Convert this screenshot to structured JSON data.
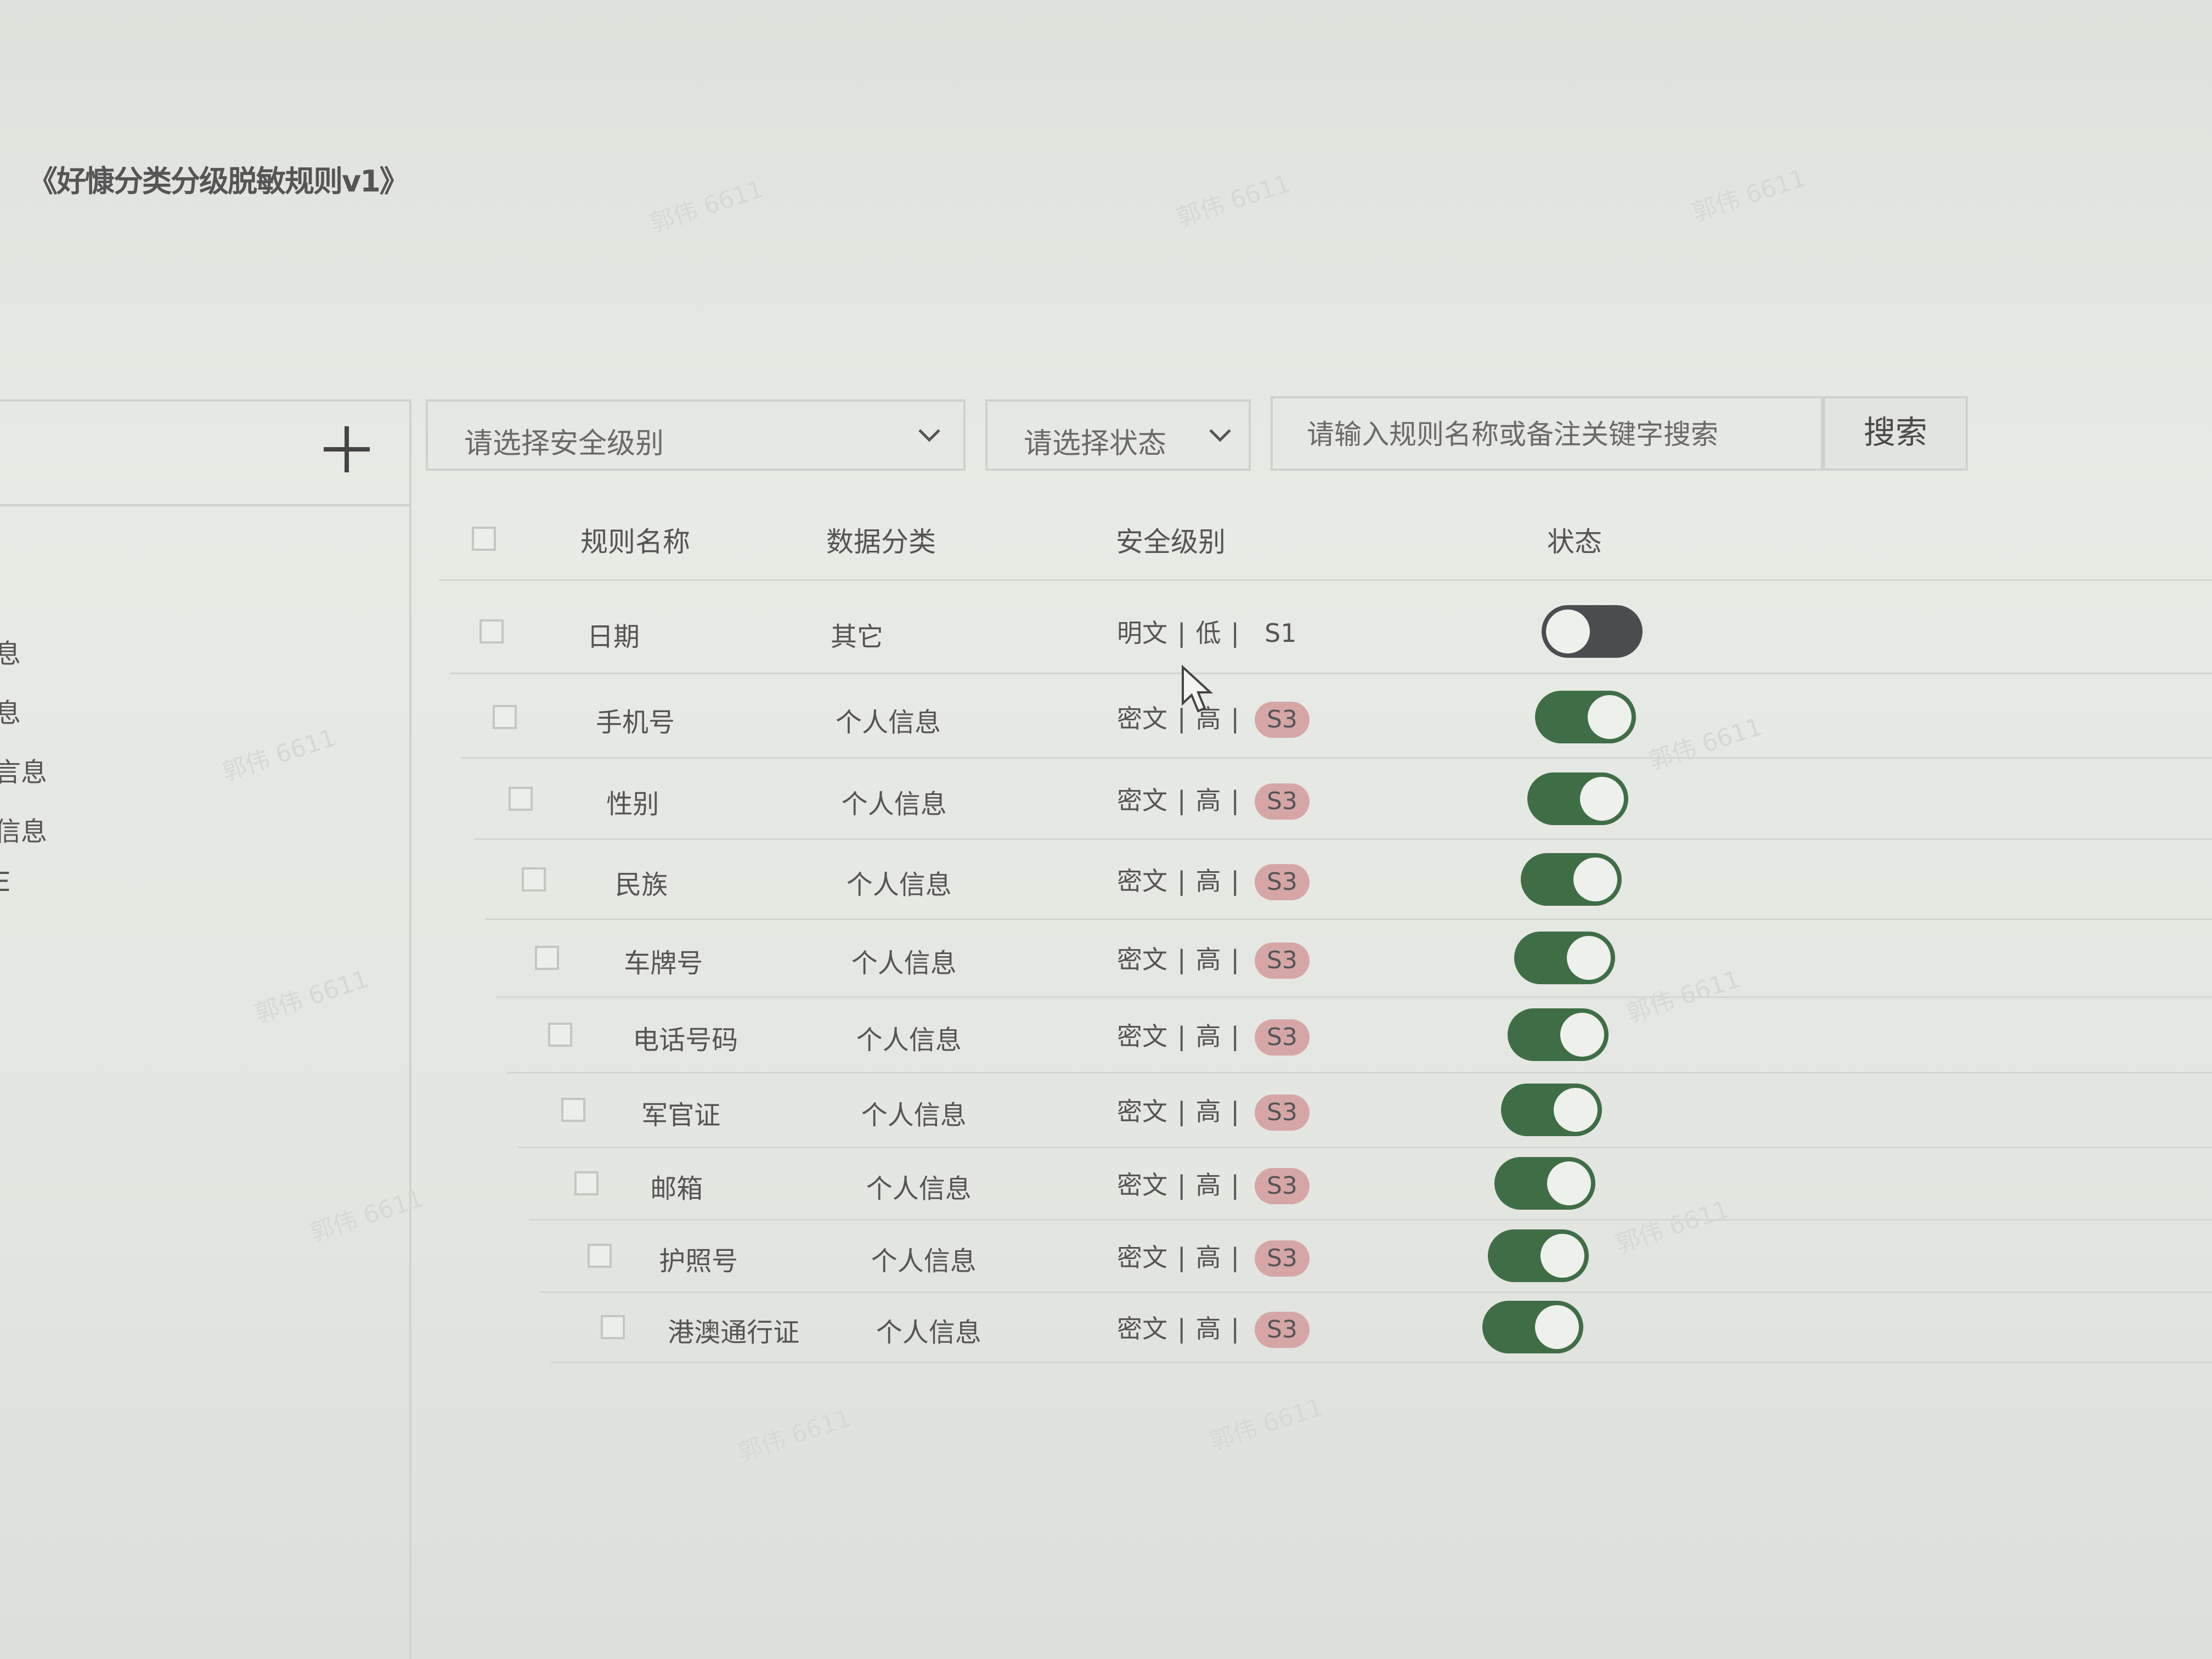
{
  "title": "《好慷分类分级脱敏规则v1》",
  "sidebar": {
    "add_icon": "plus-icon",
    "items": [
      "",
      "息",
      "息",
      "言息",
      "信息",
      "Ξ"
    ]
  },
  "toolbar": {
    "level_select_placeholder": "请选择安全级别",
    "status_select_placeholder": "请选择状态",
    "search_placeholder": "请输入规则名称或备注关键字搜索",
    "search_button": "搜索"
  },
  "table": {
    "columns": [
      "规则名称",
      "数据分类",
      "安全级别",
      "状态"
    ],
    "rows": [
      {
        "name": "日期",
        "category": "其它",
        "format": "明文",
        "risk": "低",
        "level": "S1",
        "enabled": false
      },
      {
        "name": "手机号",
        "category": "个人信息",
        "format": "密文",
        "risk": "高",
        "level": "S3",
        "enabled": true
      },
      {
        "name": "性别",
        "category": "个人信息",
        "format": "密文",
        "risk": "高",
        "level": "S3",
        "enabled": true
      },
      {
        "name": "民族",
        "category": "个人信息",
        "format": "密文",
        "risk": "高",
        "level": "S3",
        "enabled": true
      },
      {
        "name": "车牌号",
        "category": "个人信息",
        "format": "密文",
        "risk": "高",
        "level": "S3",
        "enabled": true
      },
      {
        "name": "电话号码",
        "category": "个人信息",
        "format": "密文",
        "risk": "高",
        "level": "S3",
        "enabled": true
      },
      {
        "name": "军官证",
        "category": "个人信息",
        "format": "密文",
        "risk": "高",
        "level": "S3",
        "enabled": true
      },
      {
        "name": "邮箱",
        "category": "个人信息",
        "format": "密文",
        "risk": "高",
        "level": "S3",
        "enabled": true
      },
      {
        "name": "护照号",
        "category": "个人信息",
        "format": "密文",
        "risk": "高",
        "level": "S3",
        "enabled": true
      },
      {
        "name": "港澳通行证",
        "category": "个人信息",
        "format": "密文",
        "risk": "高",
        "level": "S3",
        "enabled": true
      }
    ]
  },
  "colors": {
    "toggle_on": "#3f6e46",
    "toggle_off": "#4a4d50",
    "s3_badge": "#d6a6a6"
  },
  "watermark": "郭伟 6611"
}
